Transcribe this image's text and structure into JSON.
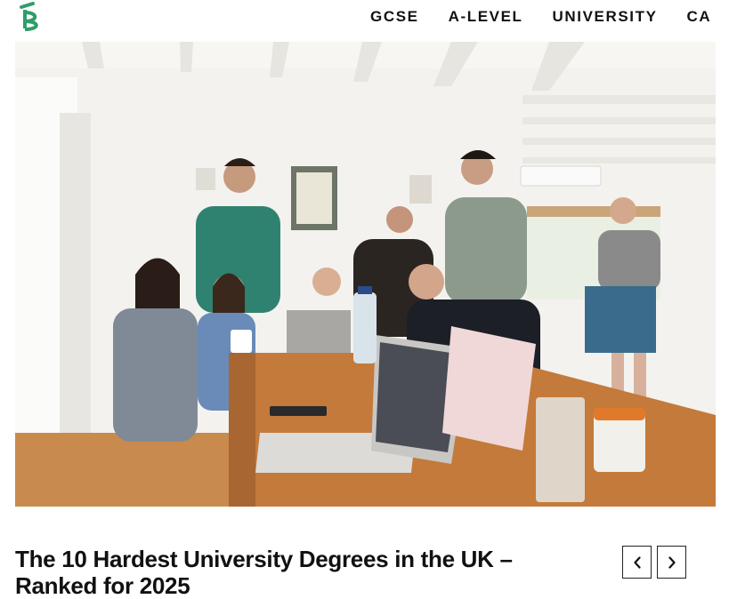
{
  "brand": {
    "logo_icon": "brand-logo-icon",
    "accent_color": "#2f9e6a"
  },
  "nav": {
    "items": [
      {
        "label": "GCSE"
      },
      {
        "label": "A-LEVEL"
      },
      {
        "label": "UNIVERSITY"
      },
      {
        "label": "CA"
      }
    ]
  },
  "hero": {
    "image": "group-of-students-around-table-with-laptops"
  },
  "article": {
    "title": "The 10 Hardest University Degrees in the UK – Ranked for 2025"
  },
  "carousel": {
    "prev_icon": "chevron-left-icon",
    "next_icon": "chevron-right-icon",
    "prev_glyph": "‹",
    "next_glyph": "›"
  }
}
